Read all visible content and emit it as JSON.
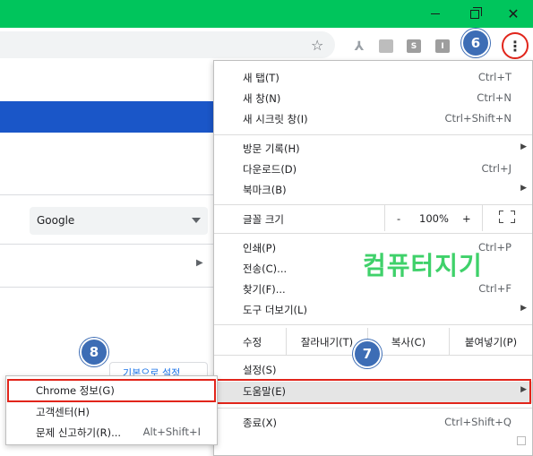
{
  "window": {
    "minimize_label": "",
    "maximize_label": "",
    "close_label": "✕"
  },
  "toolbar": {
    "star": "☆",
    "menu_dots": "⋮"
  },
  "badges": {
    "step6": "6",
    "step7": "7",
    "step8": "8"
  },
  "page": {
    "search_engine_value": "Google",
    "reset_button_label": "기본으로 설정"
  },
  "menu": {
    "items": [
      {
        "label": "새 탭(T)",
        "shortcut": "Ctrl+T"
      },
      {
        "label": "새 창(N)",
        "shortcut": "Ctrl+N"
      },
      {
        "label": "새 시크릿 창(I)",
        "shortcut": "Ctrl+Shift+N"
      },
      {
        "label": "방문 기록(H)",
        "shortcut": ""
      },
      {
        "label": "다운로드(D)",
        "shortcut": "Ctrl+J"
      },
      {
        "label": "북마크(B)",
        "shortcut": ""
      },
      {
        "label": "인쇄(P)",
        "shortcut": "Ctrl+P"
      },
      {
        "label": "전송(C)...",
        "shortcut": ""
      },
      {
        "label": "찾기(F)...",
        "shortcut": "Ctrl+F"
      },
      {
        "label": "도구 더보기(L)",
        "shortcut": ""
      },
      {
        "label": "설정(S)",
        "shortcut": ""
      },
      {
        "label": "도움말(E)",
        "shortcut": ""
      },
      {
        "label": "종료(X)",
        "shortcut": "Ctrl+Shift+Q"
      }
    ],
    "zoom": {
      "label": "글꼴 크기",
      "minus": "-",
      "value": "100%",
      "plus": "+"
    },
    "edit": {
      "label": "수정",
      "cut": "잘라내기(T)",
      "copy": "복사(C)",
      "paste": "붙여넣기(P)"
    }
  },
  "help_submenu": {
    "items": [
      {
        "label": "Chrome 정보(G)",
        "shortcut": ""
      },
      {
        "label": "고객센터(H)",
        "shortcut": ""
      },
      {
        "label": "문제 신고하기(R)...",
        "shortcut": "Alt+Shift+I"
      }
    ]
  },
  "watermark": "컴퓨터지기",
  "colors": {
    "titlebar": "#00c55c",
    "page_bar": "#1a56c8",
    "badge": "#3d6db5",
    "highlight": "#e1251b",
    "watermark": "#3fd16a"
  }
}
